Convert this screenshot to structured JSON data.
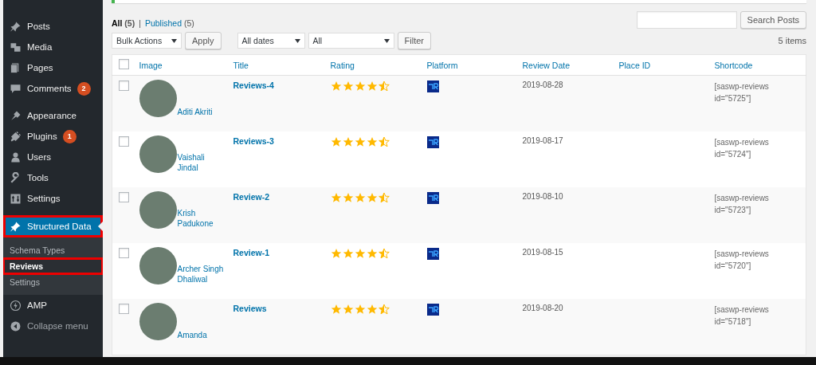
{
  "sidebar": {
    "groups": [
      [
        {
          "label": "Posts",
          "current": false,
          "annotated": false
        },
        {
          "label": "Media",
          "current": false,
          "annotated": false
        },
        {
          "label": "Pages",
          "current": false,
          "annotated": false
        },
        {
          "label": "Comments",
          "badge": "2",
          "current": false,
          "annotated": false
        }
      ],
      [
        {
          "label": "Appearance",
          "current": false,
          "annotated": false
        },
        {
          "label": "Plugins",
          "badge": "1",
          "current": false,
          "annotated": false
        },
        {
          "label": "Users",
          "current": false,
          "annotated": false
        },
        {
          "label": "Tools",
          "current": false,
          "annotated": false
        },
        {
          "label": "Settings",
          "current": false,
          "annotated": false
        }
      ],
      [
        {
          "label": "Structured Data",
          "current": true,
          "annotated": true,
          "children": [
            {
              "label": "Schema Types",
              "selected": false,
              "annotated": false
            },
            {
              "label": "Reviews",
              "selected": true,
              "annotated": true
            },
            {
              "label": "Settings",
              "selected": false,
              "annotated": false
            }
          ]
        },
        {
          "label": "AMP",
          "current": false,
          "annotated": false
        },
        {
          "label": "Collapse menu",
          "current": false,
          "annotated": false
        }
      ]
    ]
  },
  "views": {
    "separator": "|",
    "items": [
      {
        "label": "All",
        "count": "(5)",
        "selected": true
      },
      {
        "label": "Published",
        "count": "(5)",
        "selected": false
      }
    ]
  },
  "search": {
    "button": "Search Posts"
  },
  "bulk_actions": {
    "value": "Bulk Actions",
    "button": "Apply"
  },
  "filters": [
    {
      "value": "All dates"
    },
    {
      "value": "All"
    }
  ],
  "filter_button": "Filter",
  "item_count": "5 items",
  "table": {
    "select_all_checked": false,
    "columns": [
      "Image",
      "Title",
      "Rating",
      "Platform",
      "Review Date",
      "Place ID",
      "Shortcode"
    ],
    "rows": [
      {
        "checked": false,
        "reviewer": "Aditi Akriti",
        "title": "Reviews-4",
        "stars": 4.5,
        "date": "2019-08-28",
        "shortcode": "[saswp-reviews id=\"5725\"]"
      },
      {
        "checked": false,
        "reviewer": "Vaishali Jindal",
        "title": "Reviews-3",
        "stars": 4.5,
        "date": "2019-08-17",
        "shortcode": "[saswp-reviews id=\"5724\"]"
      },
      {
        "checked": false,
        "reviewer": "Krish Padukone",
        "title": "Review-2",
        "stars": 4.5,
        "date": "2019-08-10",
        "shortcode": "[saswp-reviews id=\"5723\"]"
      },
      {
        "checked": false,
        "reviewer": "Archer Singh Dhaliwal",
        "title": "Review-1",
        "stars": 4.5,
        "date": "2019-08-15",
        "shortcode": "[saswp-reviews id=\"5720\"]"
      },
      {
        "checked": false,
        "reviewer": "Amanda",
        "title": "Reviews",
        "stars": 4.5,
        "date": "2019-08-20",
        "shortcode": "[saswp-reviews id=\"5718\"]"
      }
    ]
  }
}
